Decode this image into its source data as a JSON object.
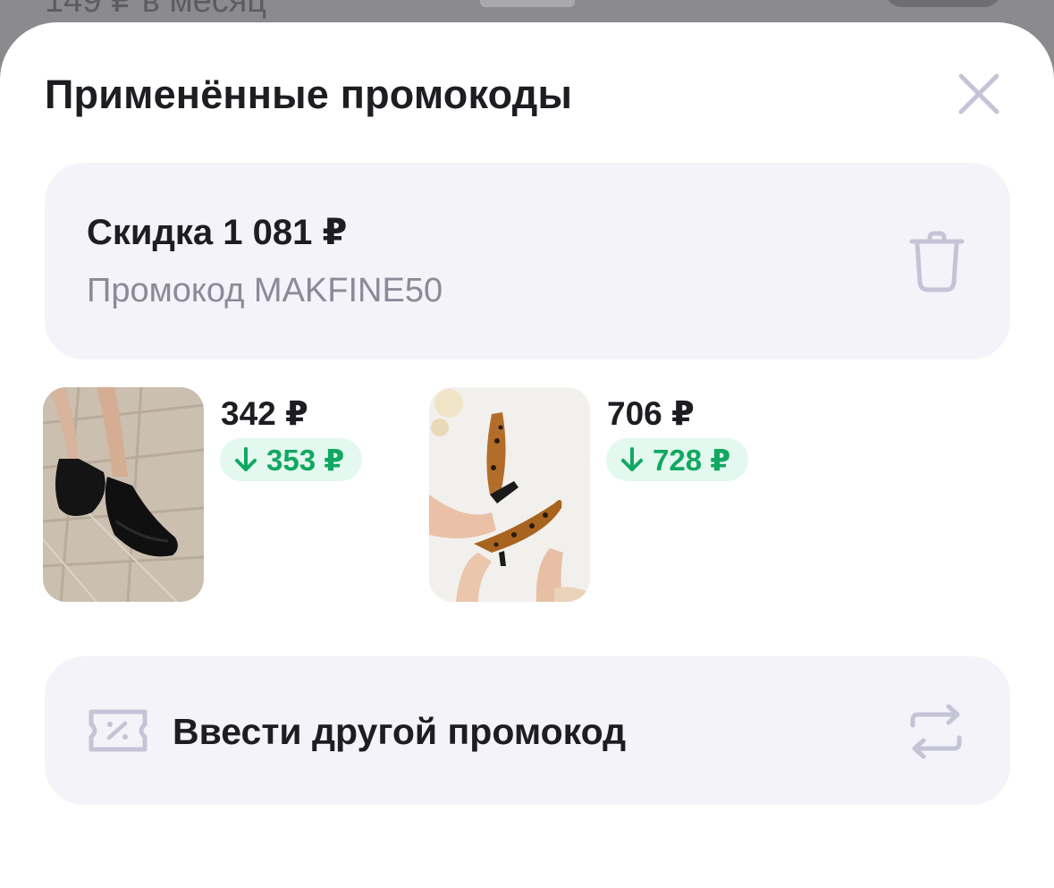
{
  "background": {
    "partial_text": "149 ₽ в месяц"
  },
  "sheet": {
    "title": "Применённые промокоды"
  },
  "promo": {
    "title": "Скидка 1 081 ₽",
    "subtitle": "Промокод MAKFINE50"
  },
  "products": [
    {
      "price": "342 ₽",
      "discount": "353 ₽"
    },
    {
      "price": "706 ₽",
      "discount": "728 ₽"
    }
  ],
  "enter_promo": {
    "label": "Ввести другой промокод"
  },
  "icons": {
    "close": "close-icon",
    "trash": "trash-icon",
    "arrow_down": "arrow-down-icon",
    "coupon": "coupon-percent-icon",
    "swap": "swap-arrows-icon"
  },
  "colors": {
    "accent_green": "#11a862",
    "badge_bg": "#e3f8ef",
    "card_bg": "#f3f3f9",
    "icon_gray": "#c5c4d6"
  }
}
